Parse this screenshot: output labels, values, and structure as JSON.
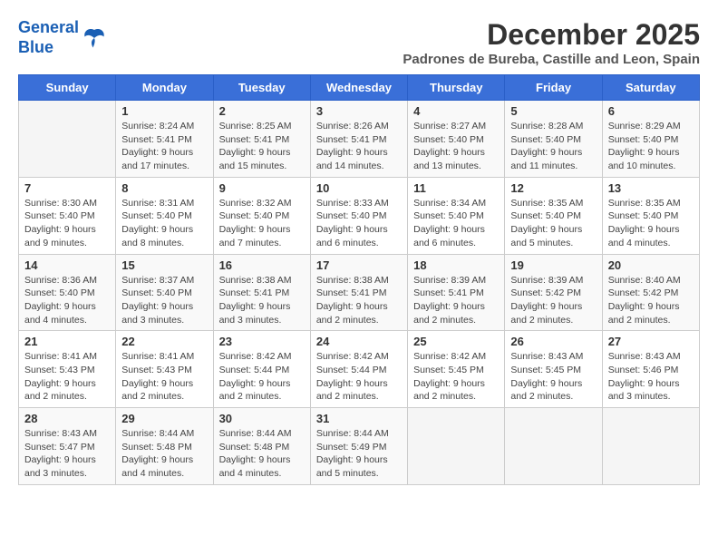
{
  "header": {
    "logo_line1": "General",
    "logo_line2": "Blue",
    "month_title": "December 2025",
    "location": "Padrones de Bureba, Castille and Leon, Spain"
  },
  "weekdays": [
    "Sunday",
    "Monday",
    "Tuesday",
    "Wednesday",
    "Thursday",
    "Friday",
    "Saturday"
  ],
  "weeks": [
    [
      {
        "day": "",
        "info": ""
      },
      {
        "day": "1",
        "info": "Sunrise: 8:24 AM\nSunset: 5:41 PM\nDaylight: 9 hours\nand 17 minutes."
      },
      {
        "day": "2",
        "info": "Sunrise: 8:25 AM\nSunset: 5:41 PM\nDaylight: 9 hours\nand 15 minutes."
      },
      {
        "day": "3",
        "info": "Sunrise: 8:26 AM\nSunset: 5:41 PM\nDaylight: 9 hours\nand 14 minutes."
      },
      {
        "day": "4",
        "info": "Sunrise: 8:27 AM\nSunset: 5:40 PM\nDaylight: 9 hours\nand 13 minutes."
      },
      {
        "day": "5",
        "info": "Sunrise: 8:28 AM\nSunset: 5:40 PM\nDaylight: 9 hours\nand 11 minutes."
      },
      {
        "day": "6",
        "info": "Sunrise: 8:29 AM\nSunset: 5:40 PM\nDaylight: 9 hours\nand 10 minutes."
      }
    ],
    [
      {
        "day": "7",
        "info": "Sunrise: 8:30 AM\nSunset: 5:40 PM\nDaylight: 9 hours\nand 9 minutes."
      },
      {
        "day": "8",
        "info": "Sunrise: 8:31 AM\nSunset: 5:40 PM\nDaylight: 9 hours\nand 8 minutes."
      },
      {
        "day": "9",
        "info": "Sunrise: 8:32 AM\nSunset: 5:40 PM\nDaylight: 9 hours\nand 7 minutes."
      },
      {
        "day": "10",
        "info": "Sunrise: 8:33 AM\nSunset: 5:40 PM\nDaylight: 9 hours\nand 6 minutes."
      },
      {
        "day": "11",
        "info": "Sunrise: 8:34 AM\nSunset: 5:40 PM\nDaylight: 9 hours\nand 6 minutes."
      },
      {
        "day": "12",
        "info": "Sunrise: 8:35 AM\nSunset: 5:40 PM\nDaylight: 9 hours\nand 5 minutes."
      },
      {
        "day": "13",
        "info": "Sunrise: 8:35 AM\nSunset: 5:40 PM\nDaylight: 9 hours\nand 4 minutes."
      }
    ],
    [
      {
        "day": "14",
        "info": "Sunrise: 8:36 AM\nSunset: 5:40 PM\nDaylight: 9 hours\nand 4 minutes."
      },
      {
        "day": "15",
        "info": "Sunrise: 8:37 AM\nSunset: 5:40 PM\nDaylight: 9 hours\nand 3 minutes."
      },
      {
        "day": "16",
        "info": "Sunrise: 8:38 AM\nSunset: 5:41 PM\nDaylight: 9 hours\nand 3 minutes."
      },
      {
        "day": "17",
        "info": "Sunrise: 8:38 AM\nSunset: 5:41 PM\nDaylight: 9 hours\nand 2 minutes."
      },
      {
        "day": "18",
        "info": "Sunrise: 8:39 AM\nSunset: 5:41 PM\nDaylight: 9 hours\nand 2 minutes."
      },
      {
        "day": "19",
        "info": "Sunrise: 8:39 AM\nSunset: 5:42 PM\nDaylight: 9 hours\nand 2 minutes."
      },
      {
        "day": "20",
        "info": "Sunrise: 8:40 AM\nSunset: 5:42 PM\nDaylight: 9 hours\nand 2 minutes."
      }
    ],
    [
      {
        "day": "21",
        "info": "Sunrise: 8:41 AM\nSunset: 5:43 PM\nDaylight: 9 hours\nand 2 minutes."
      },
      {
        "day": "22",
        "info": "Sunrise: 8:41 AM\nSunset: 5:43 PM\nDaylight: 9 hours\nand 2 minutes."
      },
      {
        "day": "23",
        "info": "Sunrise: 8:42 AM\nSunset: 5:44 PM\nDaylight: 9 hours\nand 2 minutes."
      },
      {
        "day": "24",
        "info": "Sunrise: 8:42 AM\nSunset: 5:44 PM\nDaylight: 9 hours\nand 2 minutes."
      },
      {
        "day": "25",
        "info": "Sunrise: 8:42 AM\nSunset: 5:45 PM\nDaylight: 9 hours\nand 2 minutes."
      },
      {
        "day": "26",
        "info": "Sunrise: 8:43 AM\nSunset: 5:45 PM\nDaylight: 9 hours\nand 2 minutes."
      },
      {
        "day": "27",
        "info": "Sunrise: 8:43 AM\nSunset: 5:46 PM\nDaylight: 9 hours\nand 3 minutes."
      }
    ],
    [
      {
        "day": "28",
        "info": "Sunrise: 8:43 AM\nSunset: 5:47 PM\nDaylight: 9 hours\nand 3 minutes."
      },
      {
        "day": "29",
        "info": "Sunrise: 8:44 AM\nSunset: 5:48 PM\nDaylight: 9 hours\nand 4 minutes."
      },
      {
        "day": "30",
        "info": "Sunrise: 8:44 AM\nSunset: 5:48 PM\nDaylight: 9 hours\nand 4 minutes."
      },
      {
        "day": "31",
        "info": "Sunrise: 8:44 AM\nSunset: 5:49 PM\nDaylight: 9 hours\nand 5 minutes."
      },
      {
        "day": "",
        "info": ""
      },
      {
        "day": "",
        "info": ""
      },
      {
        "day": "",
        "info": ""
      }
    ]
  ]
}
